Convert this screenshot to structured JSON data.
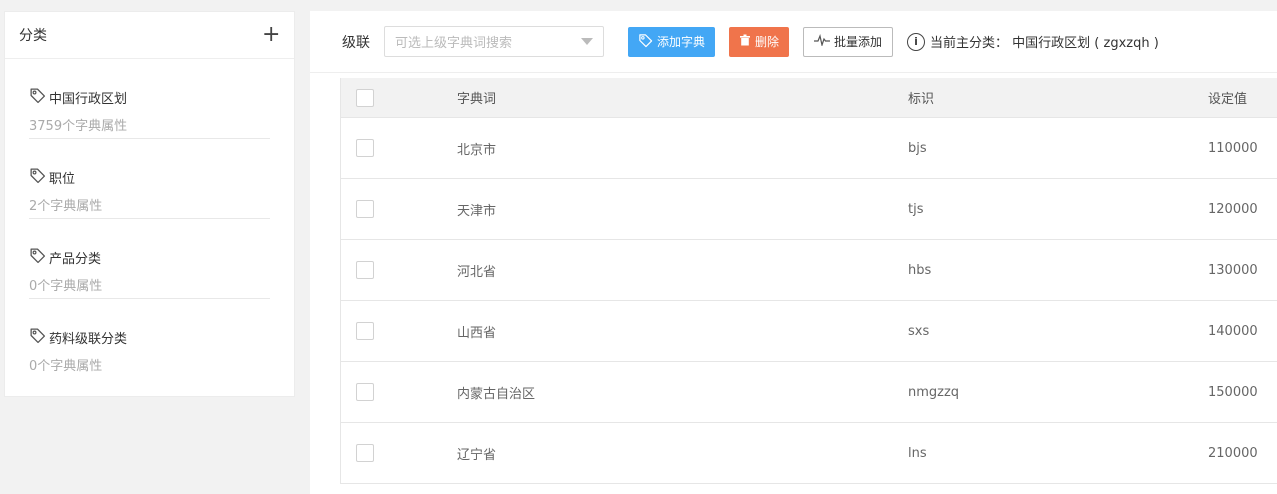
{
  "sidebar": {
    "title": "分类",
    "add_symbol": "+",
    "items": [
      {
        "name": "中国行政区划",
        "count": "3759个字典属性",
        "icon": "tag-icon"
      },
      {
        "name": "职位",
        "count": "2个字典属性",
        "icon": "tag-icon"
      },
      {
        "name": "产品分类",
        "count": "0个字典属性",
        "icon": "tag-icon"
      },
      {
        "name": "药料级联分类",
        "count": "0个字典属性",
        "icon": "tag-icon"
      }
    ]
  },
  "toolbar": {
    "cascade_label": "级联",
    "search_placeholder": "可选上级字典词搜索",
    "add_button": "添加字典",
    "delete_button": "删除",
    "batch_add_button": "批量添加",
    "info_glyph": "i",
    "current_category_text": "当前主分类： 中国行政区划 ( zgxzqh )"
  },
  "colors": {
    "accent_blue": "#43a7f5",
    "danger_orange": "#f0744b"
  },
  "table": {
    "columns": [
      "字典词",
      "标识",
      "设定值"
    ],
    "rows": [
      {
        "word": "北京市",
        "code": "bjs",
        "value": "110000"
      },
      {
        "word": "天津市",
        "code": "tjs",
        "value": "120000"
      },
      {
        "word": "河北省",
        "code": "hbs",
        "value": "130000"
      },
      {
        "word": "山西省",
        "code": "sxs",
        "value": "140000"
      },
      {
        "word": "内蒙古自治区",
        "code": "nmgzzq",
        "value": "150000"
      },
      {
        "word": "辽宁省",
        "code": "lns",
        "value": "210000"
      }
    ]
  }
}
